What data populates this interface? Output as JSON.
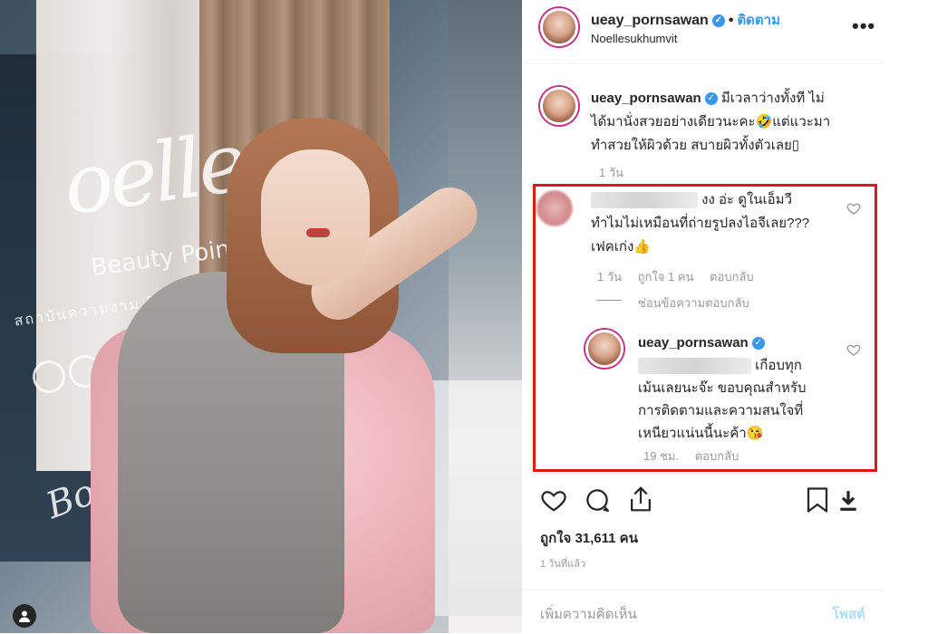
{
  "post": {
    "username": "ueay_pornsawan",
    "follow_label": "ติดตาม",
    "location": "Noellesukhumvit",
    "more_label": "•••",
    "caption_line1": "มีเวลาว่างทั้งที ไม่",
    "caption_line2": "ได้มานั่งสวยอย่างเดียวนะคะ🤣แต่แวะมา",
    "caption_line3": "ทำสวยให้ผิวด้วย สบายผิวทั้งตัวเลย▯",
    "caption_time": "1 วัน"
  },
  "comment1": {
    "line1_suffix": "งง อ่ะ ดูในเอ็มวี",
    "line2": "ทำไมไม่เหมือนที่ถ่ายรูปลงไอจีเลย???",
    "line3": "เฟคเก่ง👍",
    "time": "1 วัน",
    "likes": "ถูกใจ 1 คน",
    "reply": "ตอบกลับ",
    "hide_replies": "ซ่อนข้อความตอบกลับ"
  },
  "reply1": {
    "username": "ueay_pornsawan",
    "line1_suffix": "เกือบทุก",
    "line2": "เม้นเลยนะจ๊ะ ขอบคุณสำหรับ",
    "line3": "การติดตามและความสนใจที่",
    "line4": "เหนียวแน่นนี้นะค้า😘",
    "time": "19 ชม.",
    "reply": "ตอบกลับ"
  },
  "stats": {
    "likes": "ถูกใจ 31,611 คน",
    "ago": "1 วันที่แล้ว"
  },
  "comment_box": {
    "placeholder": "เพิ่มความคิดเห็น",
    "post_label": "โพสต์"
  },
  "photo_sign": {
    "brand": "oelle",
    "tagline": "Beauty Point",
    "subline": "สถาบันความงาม BEA",
    "body_text": "Body"
  },
  "colors": {
    "accent": "#3897f0",
    "highlight_box": "#e01818"
  }
}
